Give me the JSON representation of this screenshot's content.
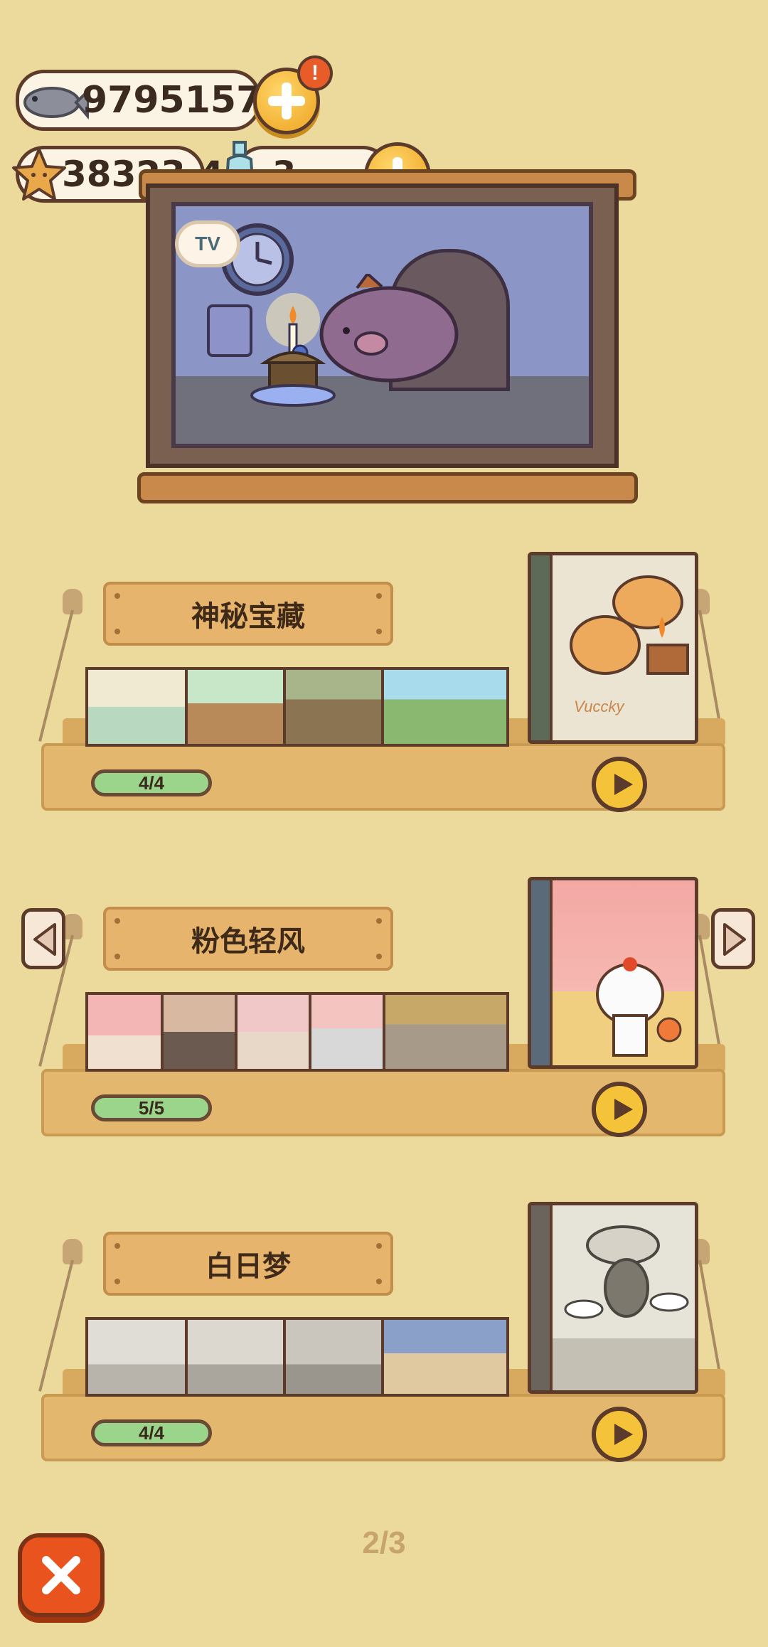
{
  "currency": {
    "fish_count": "9795157",
    "star_count": "38323.4",
    "bottle_count": "3",
    "notification_badge": "!"
  },
  "tv": {
    "badge_label": "TV"
  },
  "albums": [
    {
      "title": "神秘宝藏",
      "progress": "4/4",
      "cover_caption": "Vuccky",
      "thumb_count": 4
    },
    {
      "title": "粉色轻风",
      "progress": "5/5",
      "cover_caption": "",
      "thumb_count": 5
    },
    {
      "title": "白日梦",
      "progress": "4/4",
      "cover_caption": "",
      "thumb_count": 4
    }
  ],
  "pagination": {
    "label": "2/3"
  },
  "colors": {
    "background": "#ecd99c",
    "accent_yellow": "#f4c33a",
    "close_orange": "#e8531e",
    "progress_green": "#9bd58b",
    "outline_brown": "#5d3b2a"
  },
  "icons": [
    "fish-icon",
    "star-icon",
    "bottle-icon",
    "plus-icon",
    "play-icon",
    "close-icon",
    "chevron-left-icon",
    "chevron-right-icon",
    "clock-icon",
    "candle-icon"
  ]
}
